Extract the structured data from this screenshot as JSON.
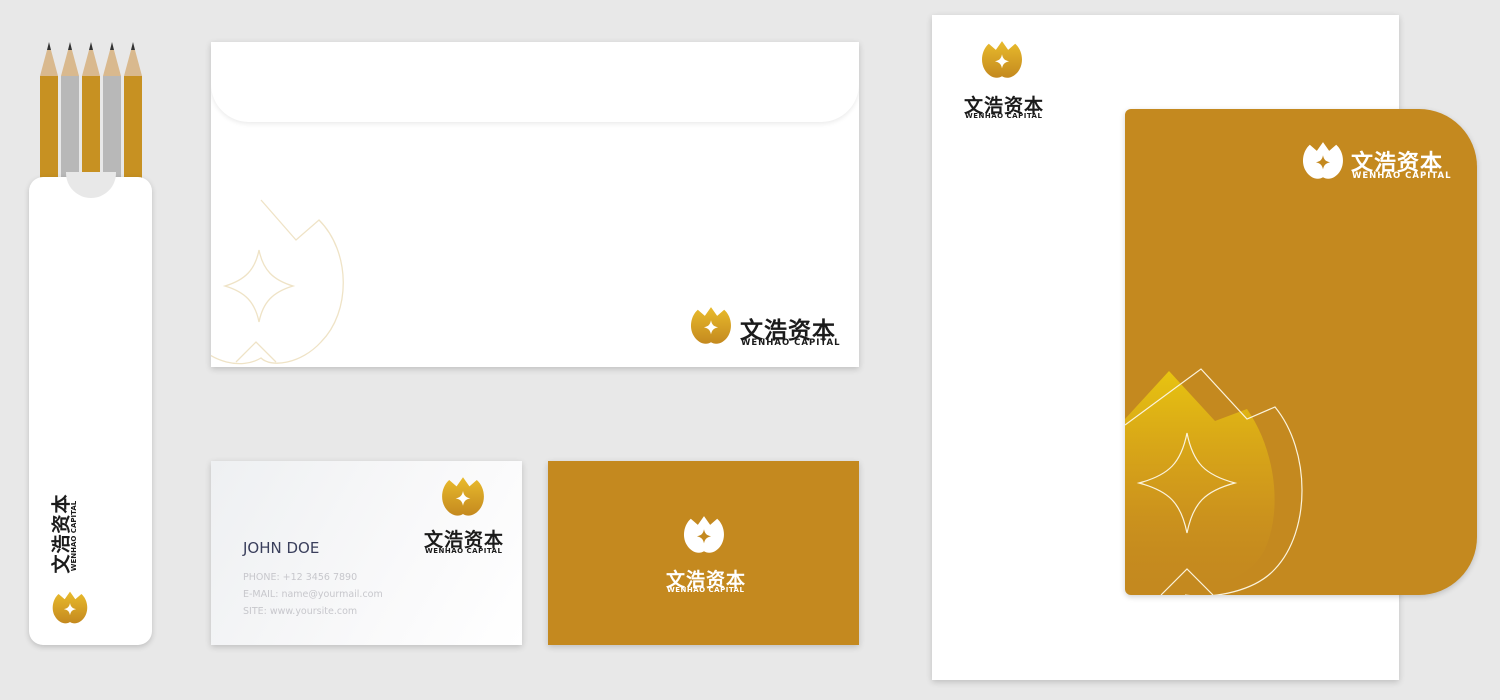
{
  "brand": {
    "name_cn": "文浩资本",
    "name_en": "WENHAO CAPITAL",
    "colors": {
      "gold": "#c4891f",
      "gold_light": "#e6b42a",
      "white": "#ffffff",
      "ink": "#1b1b1b"
    }
  },
  "business_card": {
    "name": "JOHN DOE",
    "phone": "PHONE: +12 3456 7890",
    "email": "E-MAIL: name@yourmail.com",
    "site": "SITE: www.yoursite.com"
  },
  "icons": [
    "lotus-logo-icon",
    "pencil-icon"
  ]
}
